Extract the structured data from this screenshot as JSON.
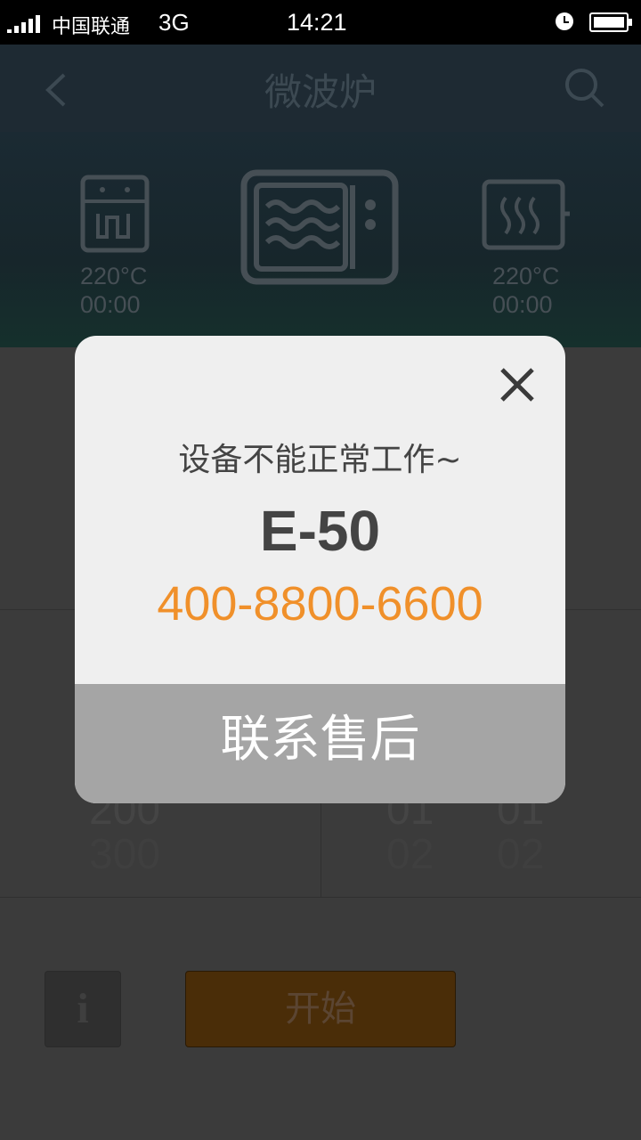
{
  "status_bar": {
    "carrier": "中国联通",
    "network": "3G",
    "time": "14:21"
  },
  "nav": {
    "title": "微波炉"
  },
  "modes": [
    {
      "name": "steam-mode",
      "temp": "220°C",
      "time": "00:00"
    },
    {
      "name": "microwave-mode"
    },
    {
      "name": "grill-mode",
      "temp": "220°C",
      "time": "00:00"
    }
  ],
  "background_values": {
    "left_col": [
      "200",
      "300"
    ],
    "mid_col": [
      "01",
      "02"
    ],
    "right_col": [
      "01",
      "02"
    ]
  },
  "bottom": {
    "info_label": "i",
    "start_label": "开始"
  },
  "dialog": {
    "message": "设备不能正常工作~",
    "error_code": "E-50",
    "phone": "400-8800-6600",
    "action_label": "联系售后"
  },
  "colors": {
    "accent_orange": "#f0902a",
    "dialog_action_bg": "#a5a5a5",
    "nav_bg": "#1e2a33"
  }
}
